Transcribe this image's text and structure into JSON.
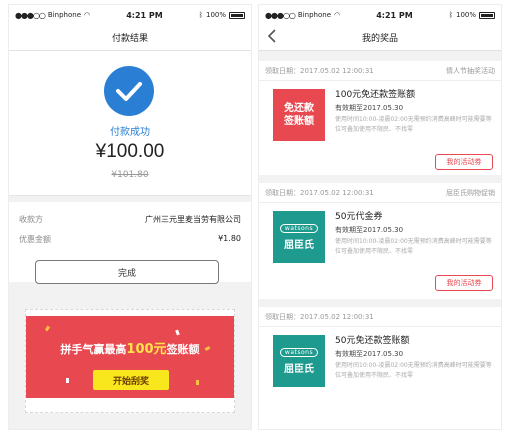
{
  "status_bar": {
    "carrier": "Binphone",
    "time": "4:21 PM",
    "battery": "100%"
  },
  "left": {
    "title": "付款结果",
    "pay_status": "付款成功",
    "amount": "¥100.00",
    "original_amount": "¥101.80",
    "rows": [
      {
        "label": "收款方",
        "value": "广州三元里麦当劳有限公司"
      },
      {
        "label": "优惠金额",
        "value": "¥1.80"
      }
    ],
    "done_label": "完成",
    "scratch": {
      "title_pre": "拼手气赢最高",
      "title_highlight": "100元",
      "title_post": "签账额",
      "button": "开始刮奖"
    }
  },
  "right": {
    "title": "我的奖品",
    "cards": [
      {
        "date_label": "领取日期：",
        "date": "2017.05.02 12:00:31",
        "source": "情人节抽奖活动",
        "thumb_line1": "免还款",
        "thumb_line2": "签账额",
        "title": "100元免还款签账额",
        "valid": "有效期至2017.05.30",
        "desc": "使用时间10:00-凌晨02:00无需预约消费高峰时可能需要等位可叠加使用不限民、不找零",
        "button": "我的活动券"
      },
      {
        "date_label": "领取日期：",
        "date": "2017.05.02 12:00:31",
        "source": "屈臣氏购物促销",
        "brand": "watsons",
        "brand_cn": "屈臣氏",
        "title": "50元代金券",
        "valid": "有效期至2017.05.30",
        "desc": "使用时间10:00-凌晨02:00无需预约消费高峰时可能需要等位可叠加使用不限民、不找零",
        "button": "我的活动券"
      },
      {
        "date_label": "领取日期：",
        "date": "2017.05.02 12:00:31",
        "source": "",
        "brand": "watsons",
        "brand_cn": "屈臣氏",
        "title": "50元免还款签账额",
        "valid": "有效期至2017.05.30",
        "desc": "使用时间10:00-凌晨02:00无需预约消费高峰时可能需要等位可叠加使用不限民、不找零",
        "button": ""
      }
    ]
  },
  "colors": {
    "primary_blue": "#2a7fd4",
    "accent_red": "#e8484f",
    "watsons_green": "#1f9a8e",
    "scratch_yellow": "#f8e71c"
  },
  "icons": {
    "check": "check-circle-icon",
    "back": "chevron-left-icon",
    "wifi": "wifi-icon",
    "signal": "signal-dots-icon",
    "bluetooth": "bluetooth-icon",
    "battery": "battery-icon"
  }
}
